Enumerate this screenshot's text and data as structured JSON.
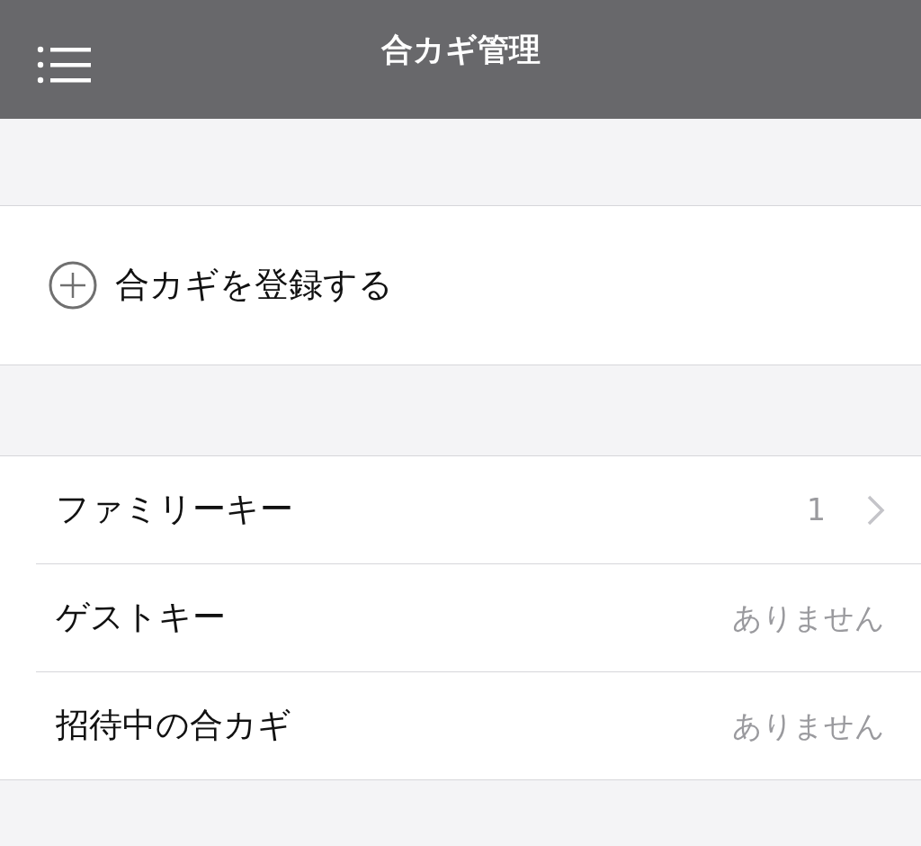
{
  "header": {
    "title": "合カギ管理"
  },
  "register_button": {
    "label": "合カギを登録する"
  },
  "key_list": [
    {
      "label": "ファミリーキー",
      "value": "1",
      "disclosure": true
    },
    {
      "label": "ゲストキー",
      "value": "ありません",
      "disclosure": false
    },
    {
      "label": "招待中の合カギ",
      "value": "ありません",
      "disclosure": false
    }
  ]
}
